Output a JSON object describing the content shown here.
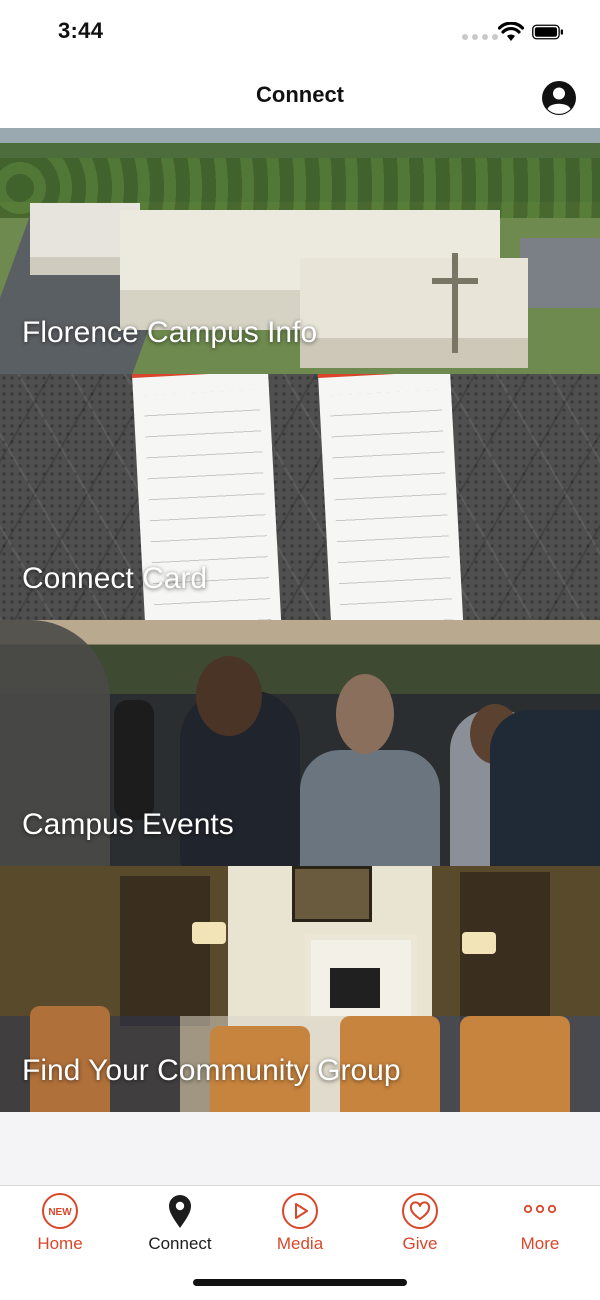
{
  "status_bar": {
    "time": "3:44",
    "icons": [
      "signal-dots-icon",
      "wifi-icon",
      "battery-icon"
    ]
  },
  "nav_bar": {
    "title": "Connect",
    "profile_icon": "person-circle-icon"
  },
  "tiles": [
    {
      "label": "Florence Campus Info"
    },
    {
      "label": "Connect Card"
    },
    {
      "label": "Campus Events"
    },
    {
      "label": "Find Your Community Group"
    }
  ],
  "tab_bar": {
    "items": [
      {
        "label": "Home",
        "icon": "new-badge-icon",
        "icon_text": "NEW"
      },
      {
        "label": "Connect",
        "icon": "location-pin-icon",
        "active": true
      },
      {
        "label": "Media",
        "icon": "play-circle-icon"
      },
      {
        "label": "Give",
        "icon": "heart-circle-icon"
      },
      {
        "label": "More",
        "icon": "more-dots-icon"
      }
    ]
  },
  "colors": {
    "accent": "#d8472a",
    "active_tab": "#1c1c1c",
    "background": "#ffffff",
    "spacer": "#f4f4f6"
  }
}
